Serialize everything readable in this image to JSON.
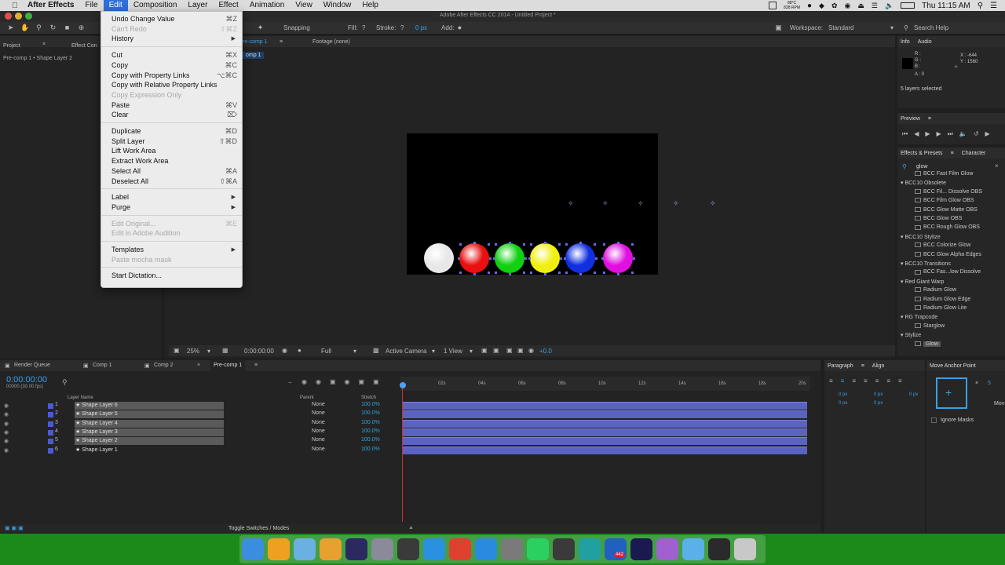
{
  "mac_menubar": {
    "app_name": "After Effects",
    "menus": [
      "File",
      "Edit",
      "Composition",
      "Layer",
      "Effect",
      "Animation",
      "View",
      "Window",
      "Help"
    ],
    "cpu_temp": "88°C",
    "fan_rpm": "838 RPM",
    "clock": "Thu 11:15 AM"
  },
  "ae": {
    "window_title": "Adobe After Effects CC 2014 - Untitled Project *",
    "toolbar": {
      "snapping": "Snapping",
      "fill": "Fill:",
      "fill_q": "?",
      "stroke": "Stroke:",
      "stroke_q": "?",
      "stroke_px": "0 px",
      "add": "Add:",
      "workspace_label": "Workspace:",
      "workspace_value": "Standard",
      "search_help": "Search Help"
    },
    "project_panel": {
      "tab_project": "Project",
      "tab_effect_controls": "Effect Con",
      "breadcrumb": "Pre-comp 1 • Shape Layer 2"
    },
    "viewer": {
      "tab_comp": "re-comp 1",
      "tab_footage": "Footage (none)",
      "comp_badge": "omp 1",
      "zoom": "25%",
      "timecode": "0:00:00:00",
      "resolution": "Full",
      "camera": "Active Camera",
      "views": "1 View",
      "exposure": "+0.0"
    },
    "info_panel": {
      "tab_info": "Info",
      "tab_audio": "Audio",
      "r": "R :",
      "g": "G :",
      "b": "B :",
      "a": "A : 0",
      "x": "X : -644",
      "y": "Y : 1560",
      "status": "5 layers selected"
    },
    "preview_panel": {
      "title": "Preview"
    },
    "effects_panel": {
      "tab_effects": "Effects & Presets",
      "tab_character": "Character",
      "search_value": "glow",
      "items": [
        {
          "label": "BCC Fast Film Glow",
          "indent": 2,
          "type": "fx"
        },
        {
          "label": "BCC10 Obsolete",
          "indent": 1,
          "type": "folder"
        },
        {
          "label": "BCC Fil... Dissolve OBS",
          "indent": 2,
          "type": "fx"
        },
        {
          "label": "BCC Film Glow OBS",
          "indent": 2,
          "type": "fx"
        },
        {
          "label": "BCC Glow Matte OBS",
          "indent": 2,
          "type": "fx"
        },
        {
          "label": "BCC Glow OBS",
          "indent": 2,
          "type": "fx"
        },
        {
          "label": "BCC Rough Glow OBS",
          "indent": 2,
          "type": "fx"
        },
        {
          "label": "BCC10 Stylize",
          "indent": 1,
          "type": "folder"
        },
        {
          "label": "BCC Colorize Glow",
          "indent": 2,
          "type": "fx"
        },
        {
          "label": "BCC Glow Alpha Edges",
          "indent": 2,
          "type": "fx"
        },
        {
          "label": "BCC10 Transitions",
          "indent": 1,
          "type": "folder"
        },
        {
          "label": "BCC Fas...low Dissolve",
          "indent": 2,
          "type": "fx"
        },
        {
          "label": "Red Giant Warp",
          "indent": 1,
          "type": "folder"
        },
        {
          "label": "Radium Glow",
          "indent": 2,
          "type": "fx"
        },
        {
          "label": "Radium Glow Edge",
          "indent": 2,
          "type": "fx"
        },
        {
          "label": "Radium Glow Lite",
          "indent": 2,
          "type": "fx"
        },
        {
          "label": "RG Trapcode",
          "indent": 1,
          "type": "folder"
        },
        {
          "label": "Starglow",
          "indent": 2,
          "type": "fx"
        },
        {
          "label": "Stylize",
          "indent": 1,
          "type": "folder"
        },
        {
          "label": "Glow",
          "indent": 2,
          "type": "fx"
        }
      ]
    },
    "edit_menu": {
      "items": [
        {
          "label": "Undo Change Value",
          "shortcut": "⌘Z",
          "disabled": false
        },
        {
          "label": "Can't Redo",
          "shortcut": "⇧⌘Z",
          "disabled": true
        },
        {
          "label": "History",
          "shortcut": "",
          "submenu": true,
          "disabled": false
        },
        {
          "label": "Cut",
          "shortcut": "⌘X",
          "disabled": false
        },
        {
          "label": "Copy",
          "shortcut": "⌘C",
          "disabled": false
        },
        {
          "label": "Copy with Property Links",
          "shortcut": "⌥⌘C",
          "disabled": false
        },
        {
          "label": "Copy with Relative Property Links",
          "shortcut": "",
          "disabled": false
        },
        {
          "label": "Copy Expression Only",
          "shortcut": "",
          "disabled": true
        },
        {
          "label": "Paste",
          "shortcut": "⌘V",
          "disabled": false
        },
        {
          "label": "Clear",
          "shortcut": "⌦",
          "disabled": false
        },
        {
          "label": "Duplicate",
          "shortcut": "⌘D",
          "disabled": false
        },
        {
          "label": "Split Layer",
          "shortcut": "⇧⌘D",
          "disabled": false
        },
        {
          "label": "Lift Work Area",
          "shortcut": "",
          "disabled": false
        },
        {
          "label": "Extract Work Area",
          "shortcut": "",
          "disabled": false
        },
        {
          "label": "Select All",
          "shortcut": "⌘A",
          "disabled": false
        },
        {
          "label": "Deselect All",
          "shortcut": "⇧⌘A",
          "disabled": false
        },
        {
          "label": "Label",
          "shortcut": "",
          "submenu": true,
          "disabled": false
        },
        {
          "label": "Purge",
          "shortcut": "",
          "submenu": true,
          "disabled": false
        },
        {
          "label": "Edit Original...",
          "shortcut": "⌘E",
          "disabled": true
        },
        {
          "label": "Edit in Adobe Audition",
          "shortcut": "",
          "disabled": true
        },
        {
          "label": "Templates",
          "shortcut": "",
          "submenu": true,
          "disabled": false
        },
        {
          "label": "Paste mocha mask",
          "shortcut": "",
          "disabled": true
        },
        {
          "label": "Start Dictation...",
          "shortcut": "",
          "disabled": false
        }
      ]
    },
    "timeline": {
      "tabs": [
        "Render Queue",
        "Comp 1",
        "Comp 2",
        "Pre-comp 1"
      ],
      "timecode": "0:00:00:00",
      "fps": "00000 (30.00 fps)",
      "col_layer_name": "Layer Name",
      "col_parent": "Parent",
      "col_stretch": "Stretch",
      "ruler": [
        "02s",
        "04s",
        "06s",
        "08s",
        "10s",
        "12s",
        "14s",
        "16s",
        "18s",
        "20s"
      ],
      "layers": [
        {
          "num": "1",
          "name": "Shape Layer 6",
          "parent": "None",
          "stretch": "100.0%",
          "selected": true
        },
        {
          "num": "2",
          "name": "Shape Layer 5",
          "parent": "None",
          "stretch": "100.0%",
          "selected": true
        },
        {
          "num": "3",
          "name": "Shape Layer 4",
          "parent": "None",
          "stretch": "100.0%",
          "selected": true
        },
        {
          "num": "4",
          "name": "Shape Layer 3",
          "parent": "None",
          "stretch": "100.0%",
          "selected": true
        },
        {
          "num": "5",
          "name": "Shape Layer 2",
          "parent": "None",
          "stretch": "100.0%",
          "selected": true
        },
        {
          "num": "6",
          "name": "Shape Layer 1",
          "parent": "None",
          "stretch": "100.0%",
          "selected": false
        }
      ],
      "toggle_label": "Toggle Switches / Modes"
    },
    "paragraph_panel": {
      "tab_paragraph": "Paragraph",
      "tab_align": "Align",
      "px1": "0 px",
      "px2": "0 px",
      "px3": "0 px",
      "px4": "0 px",
      "px5": "0 px"
    },
    "anchor_panel": {
      "title": "Move Anchor Point",
      "value": "5",
      "ignore_masks": "Ignore Masks",
      "mov": "Mov"
    }
  },
  "comp_balls": [
    {
      "color": "#e8e8e8"
    },
    {
      "color": "#e81010"
    },
    {
      "color": "#10d010"
    },
    {
      "color": "#f0f010"
    },
    {
      "color": "#1030e0"
    },
    {
      "color": "#e010e0"
    }
  ],
  "dock_apps": [
    {
      "name": "finder",
      "color": "#3b8de0"
    },
    {
      "name": "clapper",
      "color": "#f0a020"
    },
    {
      "name": "safari-like",
      "color": "#6ab0e0"
    },
    {
      "name": "lamp",
      "color": "#e8a030"
    },
    {
      "name": "quicktime",
      "color": "#2a2a60"
    },
    {
      "name": "rocket",
      "color": "#8a8a9a"
    },
    {
      "name": "davinci",
      "color": "#3a3a3a"
    },
    {
      "name": "safari",
      "color": "#2a90e0"
    },
    {
      "name": "chrome",
      "color": "#e04030"
    },
    {
      "name": "app-store",
      "color": "#2a8ae0"
    },
    {
      "name": "system-prefs",
      "color": "#7a7a7a"
    },
    {
      "name": "whatsapp",
      "color": "#2ad060"
    },
    {
      "name": "compressor",
      "color": "#3a3a3a"
    },
    {
      "name": "edge",
      "color": "#20a0a0"
    },
    {
      "name": "klokki",
      "color": "#2060c0"
    },
    {
      "name": "after-effects",
      "color": "#1a1a50"
    },
    {
      "name": "palette",
      "color": "#a060d0"
    },
    {
      "name": "folder",
      "color": "#5ab0e8"
    },
    {
      "name": "terminal",
      "color": "#2a2a2a"
    },
    {
      "name": "trash",
      "color": "#c8c8c8"
    }
  ],
  "dock_badge": "442"
}
